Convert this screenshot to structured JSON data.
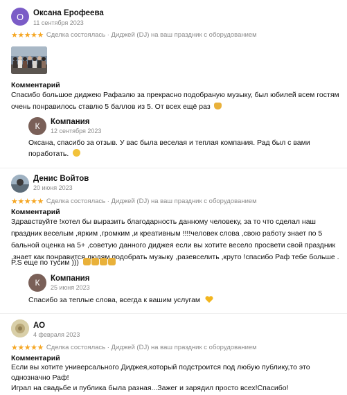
{
  "colors": {
    "star": "#f5a623",
    "avatar_o": "#7b5cc7",
    "avatar_k": "#7a6058"
  },
  "reviews": [
    {
      "author": "Оксана Ерофеева",
      "avatar_letter": "О",
      "date": "11 сентября 2023",
      "stars": "★★★★★",
      "deal": "Сделка состоялась · Диджей (DJ) на ваш праздник с оборудованием",
      "comment_label": "Комментарий",
      "comment_lines": [
        "Спасибо большое диджею Рафаэлю за прекрасно подобраную музыку, был юбилей всем гостям",
        "очень понравилось ставлю 5 баллов из 5. От всех ещё раз"
      ],
      "reply": {
        "author": "Компания",
        "avatar_letter": "К",
        "date": "12 сентября 2023",
        "lines": [
          "Оксана, спасибо за отзыв. У вас была веселая и теплая компания. Рад был с вами",
          "поработать."
        ]
      }
    },
    {
      "author": "Денис Войтов",
      "date": "20 июня 2023",
      "stars": "★★★★★",
      "deal": "Сделка состоялась · Диджей (DJ) на ваш праздник с оборудованием",
      "comment_label": "Комментарий",
      "comment_lines": [
        "Здравствуйте !хотел бы выразить благодарность данному человеку, за то что сделал наш",
        "праздник веселым ,ярким ,громким ,и креативным !!!!человек слова ,свою работу знает по 5",
        "бальной оценка на 5+ ,советую данного диджея если вы хотите весело просвети свой праздник",
        ",знает как понравится людям подобрать музыку ,разевселить ,круто !спасибо Раф тебе больше .",
        "P.S еще по тусим )))"
      ],
      "reply": {
        "author": "Компания",
        "avatar_letter": "К",
        "date": "25 июня 2023",
        "lines": [
          "Спасибо за теплые слова, всегда к вашим услугам"
        ]
      }
    },
    {
      "author": "АО",
      "date": "4 февраля 2023",
      "stars": "★★★★★",
      "deal": "Сделка состоялась · Диджей (DJ) на ваш праздник с оборудованием",
      "comment_label": "Комментарий",
      "comment_lines": [
        "Если вы хотите универсального Диджея,который подстроится под любую публику,то это",
        "однозначно Раф!",
        "Играл на свадьбе и публика была разная...Зажег и зарядил просто всех!Спасибо!"
      ]
    }
  ]
}
